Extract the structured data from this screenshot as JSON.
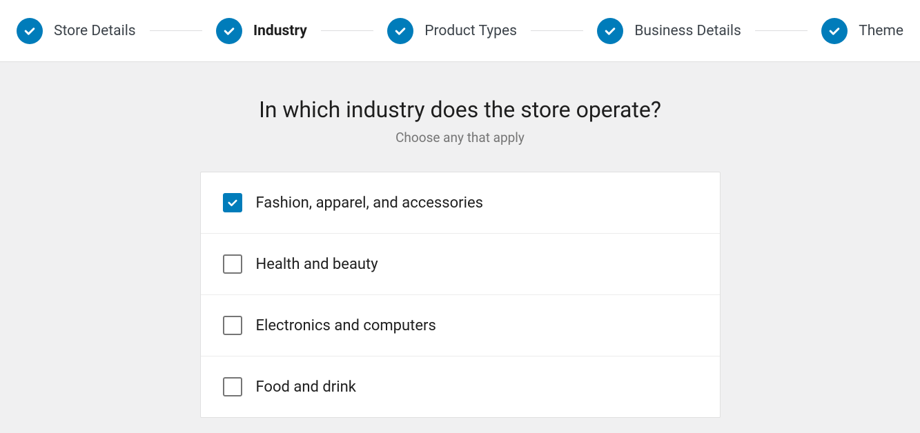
{
  "stepper": {
    "steps": [
      {
        "label": "Store Details",
        "complete": true,
        "current": false
      },
      {
        "label": "Industry",
        "complete": true,
        "current": true
      },
      {
        "label": "Product Types",
        "complete": true,
        "current": false
      },
      {
        "label": "Business Details",
        "complete": true,
        "current": false
      },
      {
        "label": "Theme",
        "complete": true,
        "current": false
      }
    ]
  },
  "main": {
    "title": "In which industry does the store operate?",
    "subtitle": "Choose any that apply",
    "options": [
      {
        "label": "Fashion, apparel, and accessories",
        "checked": true
      },
      {
        "label": "Health and beauty",
        "checked": false
      },
      {
        "label": "Electronics and computers",
        "checked": false
      },
      {
        "label": "Food and drink",
        "checked": false
      }
    ]
  }
}
